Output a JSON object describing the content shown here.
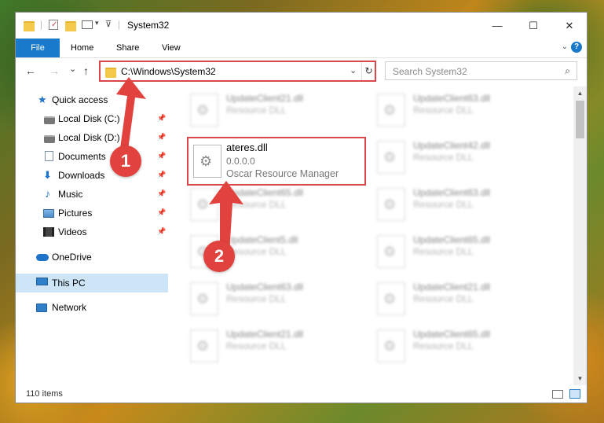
{
  "window": {
    "title": "System32",
    "controls": {
      "minimize": "—",
      "maximize": "☐",
      "close": "✕"
    }
  },
  "ribbon": {
    "tabs": [
      "File",
      "Home",
      "Share",
      "View"
    ],
    "help": "?"
  },
  "navigation": {
    "back": "←",
    "forward": "→",
    "recent": "⌄",
    "up": "↑"
  },
  "address": {
    "path": "C:\\Windows\\System32",
    "dropdown": "⌄",
    "refresh": "↻"
  },
  "search": {
    "placeholder": "Search System32",
    "icon": "⌕"
  },
  "navpane": {
    "items": [
      {
        "label": "Quick access",
        "icon": "star-icon",
        "pinned": false
      },
      {
        "label": "Local Disk (C:)",
        "icon": "drive-icon",
        "pinned": true
      },
      {
        "label": "Local Disk (D:)",
        "icon": "drive-icon",
        "pinned": true
      },
      {
        "label": "Documents",
        "icon": "documents-icon",
        "pinned": true
      },
      {
        "label": "Downloads",
        "icon": "download-icon",
        "pinned": true
      },
      {
        "label": "Music",
        "icon": "music-icon",
        "pinned": true
      },
      {
        "label": "Pictures",
        "icon": "pictures-icon",
        "pinned": true
      },
      {
        "label": "Videos",
        "icon": "videos-icon",
        "pinned": true
      },
      {
        "label": "OneDrive",
        "icon": "cloud-icon",
        "pinned": false
      },
      {
        "label": "This PC",
        "icon": "computer-icon",
        "pinned": false,
        "selected": true
      },
      {
        "label": "Network",
        "icon": "network-icon",
        "pinned": false
      }
    ],
    "pin_glyph": "📌"
  },
  "files": {
    "left_column": [
      {
        "name": "UpdateClient21.dll",
        "type": "Resource DLL"
      },
      {
        "name": "ateres.dll",
        "version": "0.0.0.0",
        "company": "Oscar Resource Manager",
        "highlighted": true
      },
      {
        "name": "UpdateClient65.dll",
        "type": "Resource DLL"
      },
      {
        "name": "UpdateClient5.dll",
        "type": "Resource DLL"
      },
      {
        "name": "UpdateClient63.dll",
        "type": "Resource DLL"
      },
      {
        "name": "UpdateClient21.dll",
        "type": "Resource DLL"
      }
    ],
    "right_column": [
      {
        "name": "UpdateClient63.dll",
        "type": "Resource DLL"
      },
      {
        "name": "UpdateClient42.dll",
        "type": "Resource DLL"
      },
      {
        "name": "UpdateClient63.dll",
        "type": "Resource DLL"
      },
      {
        "name": "UpdateClient65.dll",
        "type": "Resource DLL"
      },
      {
        "name": "UpdateClient21.dll",
        "type": "Resource DLL"
      },
      {
        "name": "UpdateClient65.dll",
        "type": "Resource DLL"
      }
    ]
  },
  "statusbar": {
    "item_count": "110 items"
  },
  "annotations": {
    "step1": "1",
    "step2": "2",
    "color": "#e2423e"
  }
}
